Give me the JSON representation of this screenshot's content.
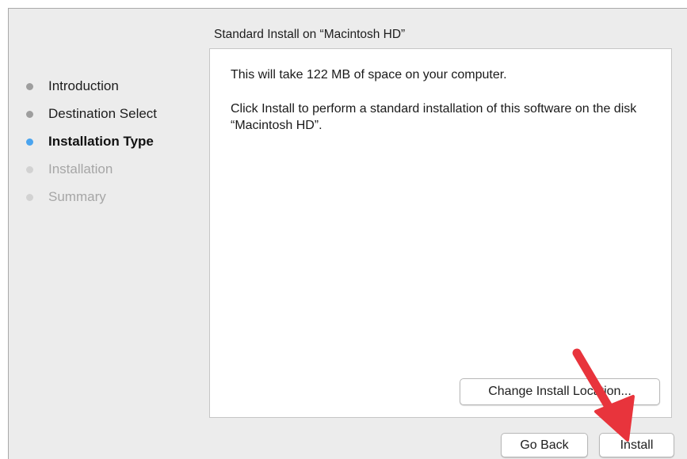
{
  "pane": {
    "title": "Standard Install on “Macintosh HD”"
  },
  "steps": [
    {
      "label": "Introduction",
      "state": "done"
    },
    {
      "label": "Destination Select",
      "state": "done"
    },
    {
      "label": "Installation Type",
      "state": "current"
    },
    {
      "label": "Installation",
      "state": "future"
    },
    {
      "label": "Summary",
      "state": "future"
    }
  ],
  "content": {
    "space_text": "This will take 122 MB of space on your computer.",
    "instruction_text": "Click Install to perform a standard installation of this software on the disk “Macintosh HD”."
  },
  "buttons": {
    "change_location": "Change Install Location...",
    "go_back": "Go Back",
    "install": "Install"
  },
  "colors": {
    "current_step_dot": "#4aa4ef",
    "annotation_arrow": "#e8343c"
  },
  "icons": {
    "annotation": "red-arrow-icon"
  }
}
